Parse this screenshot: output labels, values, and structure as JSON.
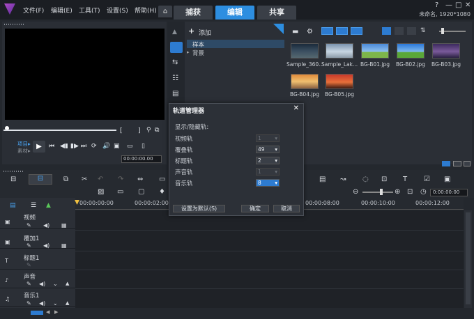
{
  "menu": {
    "file": "文件(F)",
    "edit": "编辑(E)",
    "tools": "工具(T)",
    "settings": "设置(S)",
    "help": "帮助(H)"
  },
  "tabs": [
    {
      "label": "捕获"
    },
    {
      "label": "编辑"
    },
    {
      "label": "共享"
    }
  ],
  "project_info": "未命名, 1920*1080",
  "preview": {
    "project_label": "项目▸",
    "clip_label": "素材▸",
    "timecode": "00:00:00.00"
  },
  "library": {
    "add_label": "添加",
    "tree": [
      {
        "label": "样本"
      },
      {
        "label": "背景"
      }
    ],
    "thumbnails": [
      {
        "caption": "Sample_360..."
      },
      {
        "caption": "Sample_Lak..."
      },
      {
        "caption": "BG-B01.jpg"
      },
      {
        "caption": "BG-B02.jpg"
      },
      {
        "caption": "BG-B03.jpg"
      },
      {
        "caption": "BG-B04.jpg"
      },
      {
        "caption": "BG-B05.jpg"
      }
    ]
  },
  "dialog": {
    "title": "轨道管理器",
    "section": "显示/隐藏轨:",
    "rows": [
      {
        "label": "视频轨",
        "value": "1"
      },
      {
        "label": "覆叠轨",
        "value": "49"
      },
      {
        "label": "标题轨",
        "value": "2"
      },
      {
        "label": "声音轨",
        "value": "1"
      },
      {
        "label": "音乐轨",
        "value": "8"
      }
    ],
    "buttons": {
      "default": "设置为默认(S)",
      "ok": "确定",
      "cancel": "取消"
    }
  },
  "timeline": {
    "timecode": "0:00:00:00",
    "ruler": [
      "00:00:00:00",
      "00:00:02:00",
      "00:00:08:00",
      "00:00:10:00",
      "00:00:12:00"
    ],
    "tracks": [
      {
        "name": "视频"
      },
      {
        "name": "覆加1"
      },
      {
        "name": "标题1"
      },
      {
        "name": "声音"
      },
      {
        "name": "音乐1"
      }
    ]
  },
  "colors": {
    "accent": "#2d8ee0",
    "background": "#24282e"
  }
}
